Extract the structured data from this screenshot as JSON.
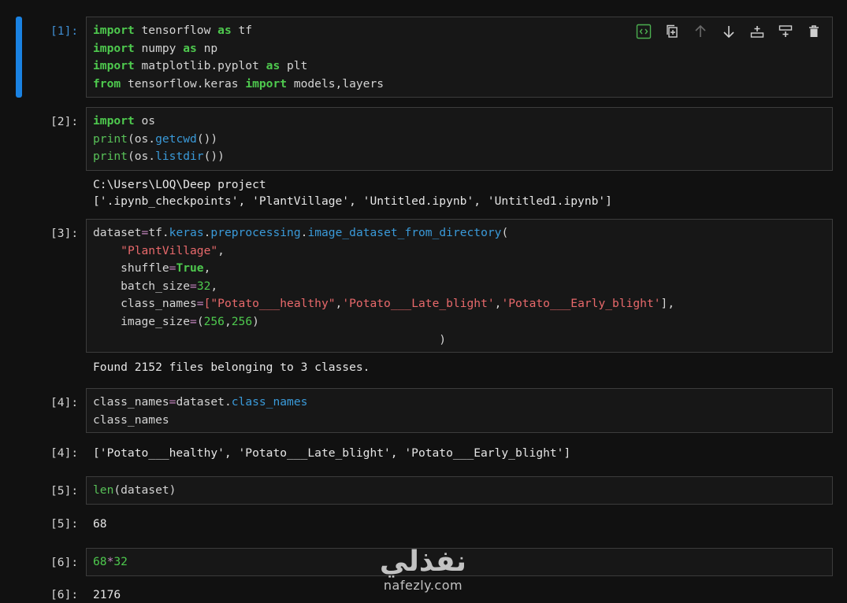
{
  "cells": [
    {
      "prompt": "[1]:",
      "lines": [
        [
          [
            "import",
            "kw"
          ],
          [
            " tensorflow ",
            ""
          ],
          [
            "as",
            "kw"
          ],
          [
            " tf",
            ""
          ]
        ],
        [
          [
            "import",
            "kw"
          ],
          [
            " numpy ",
            ""
          ],
          [
            "as",
            "kw"
          ],
          [
            " np",
            ""
          ]
        ],
        [
          [
            "import",
            "kw"
          ],
          [
            " matplotlib.pyplot ",
            ""
          ],
          [
            "as",
            "kw"
          ],
          [
            " plt",
            ""
          ]
        ],
        [
          [
            "from",
            "kw"
          ],
          [
            " tensorflow.keras ",
            ""
          ],
          [
            "import",
            "kw"
          ],
          [
            " models,layers",
            ""
          ]
        ]
      ]
    },
    {
      "prompt": "[2]:",
      "lines": [
        [
          [
            "import",
            "kw"
          ],
          [
            " os",
            ""
          ]
        ],
        [
          [
            "print",
            "bi"
          ],
          [
            "(os.",
            ""
          ],
          [
            "getcwd",
            "fn"
          ],
          [
            "())",
            ""
          ]
        ],
        [
          [
            "print",
            "bi"
          ],
          [
            "(os.",
            ""
          ],
          [
            "listdir",
            "fn"
          ],
          [
            "())",
            ""
          ]
        ]
      ],
      "output": [
        "C:\\Users\\LOQ\\Deep project",
        "['.ipynb_checkpoints', 'PlantVillage', 'Untitled.ipynb', 'Untitled1.ipynb']"
      ]
    },
    {
      "prompt": "[3]:",
      "lines": [
        [
          [
            "dataset",
            ""
          ],
          [
            "=",
            "op"
          ],
          [
            "tf.",
            ""
          ],
          [
            "keras",
            "fn"
          ],
          [
            ".",
            ""
          ],
          [
            "preprocessing",
            "fn"
          ],
          [
            ".",
            ""
          ],
          [
            "image_dataset_from_directory",
            "fn"
          ],
          [
            "(",
            ""
          ]
        ],
        [
          [
            "    ",
            ""
          ],
          [
            "\"PlantVillage\"",
            "st"
          ],
          [
            ",",
            ""
          ]
        ],
        [
          [
            "    shuffle",
            ""
          ],
          [
            "=",
            "op"
          ],
          [
            "True",
            "kw"
          ],
          [
            ",",
            ""
          ]
        ],
        [
          [
            "    batch_size",
            ""
          ],
          [
            "=",
            "op"
          ],
          [
            "32",
            "nu"
          ],
          [
            ",",
            ""
          ]
        ],
        [
          [
            "    class_names",
            ""
          ],
          [
            "=",
            "op"
          ],
          [
            "[",
            "st"
          ],
          [
            "\"Potato___healthy\"",
            "st"
          ],
          [
            ",",
            ""
          ],
          [
            "'Potato___Late_blight'",
            "st"
          ],
          [
            ",",
            ""
          ],
          [
            "'Potato___Early_blight'",
            "st"
          ],
          [
            "],",
            ""
          ]
        ],
        [
          [
            "    image_size",
            ""
          ],
          [
            "=",
            "op"
          ],
          [
            "(",
            ""
          ],
          [
            "256",
            "nu"
          ],
          [
            ",",
            ""
          ],
          [
            "256",
            "nu"
          ],
          [
            ")",
            ""
          ]
        ],
        [
          [
            "                                                  )",
            ""
          ]
        ]
      ],
      "output": [
        "Found 2152 files belonging to 3 classes."
      ]
    },
    {
      "prompt": "[4]:",
      "lines": [
        [
          [
            "class_names",
            ""
          ],
          [
            "=",
            "op"
          ],
          [
            "dataset.",
            ""
          ],
          [
            "class_names",
            "fn"
          ]
        ],
        [
          [
            "class_names",
            ""
          ]
        ]
      ],
      "out_prompt": "[4]:",
      "output": [
        "['Potato___healthy', 'Potato___Late_blight', 'Potato___Early_blight']"
      ]
    },
    {
      "prompt": "[5]:",
      "lines": [
        [
          [
            "len",
            "bi"
          ],
          [
            "(dataset)",
            ""
          ]
        ]
      ],
      "out_prompt": "[5]:",
      "output": [
        "68"
      ]
    },
    {
      "prompt": "[6]:",
      "lines": [
        [
          [
            "68",
            "nu"
          ],
          [
            "*",
            "op"
          ],
          [
            "32",
            "nu"
          ]
        ]
      ],
      "out_prompt": "[6]:",
      "output": [
        "2176"
      ]
    }
  ],
  "toolbar": {
    "icons": [
      "code-view-icon",
      "duplicate-icon",
      "move-up-icon",
      "move-down-icon",
      "insert-above-icon",
      "insert-below-icon",
      "delete-icon"
    ]
  },
  "watermark": {
    "arabic": "نفذلي",
    "latin": "nafezly.com"
  },
  "colors": {
    "active_bar": "#1a82e2",
    "keyword": "#4ec94e",
    "function": "#3a9ad9",
    "string": "#e8696b",
    "operator": "#c586c0",
    "background": "#111111"
  }
}
